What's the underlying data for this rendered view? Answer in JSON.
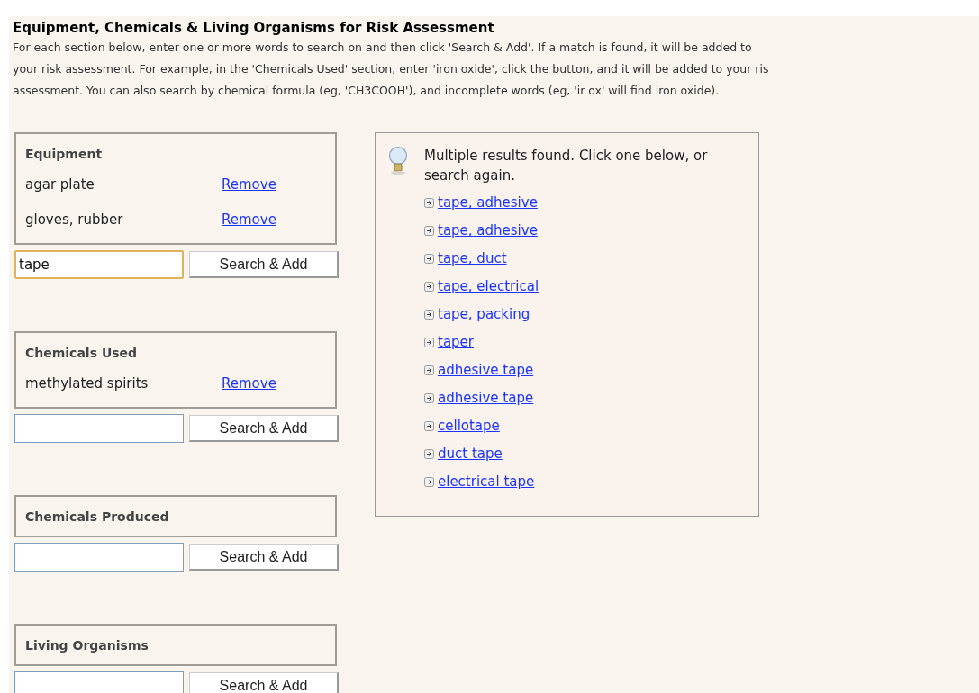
{
  "title": "Equipment, Chemicals & Living Organisms for Risk Assessment",
  "intro_lines": [
    "For each section below, enter one or more words to search on and then click 'Search & Add'. If a match is found, it will be added to",
    "your risk assessment. For example, in the 'Chemicals Used' section, enter 'iron oxide', click the button, and it will be added to your ris",
    "assessment. You can also search by chemical formula (eg, 'CH3COOH'), and incomplete words (eg, 'ir ox' will find iron oxide)."
  ],
  "sections": [
    {
      "heading": "Equipment",
      "items": [
        {
          "name": "agar plate",
          "action": "Remove"
        },
        {
          "name": "gloves, rubber",
          "action": "Remove"
        }
      ],
      "search": {
        "value": "tape",
        "focused": true
      },
      "button": "Search & Add"
    },
    {
      "heading": "Chemicals Used",
      "items": [
        {
          "name": "methylated spirits",
          "action": "Remove"
        }
      ],
      "search": {
        "focused": false
      },
      "button": "Search & Add"
    },
    {
      "heading": "Chemicals Produced",
      "search": {
        "focused": false
      },
      "button": "Search & Add"
    },
    {
      "heading": "Living Organisms",
      "search": {
        "focused": false
      },
      "button": "Search & Add"
    }
  ],
  "results": {
    "message": "Multiple results found. Click one below, or search again.",
    "items": [
      "tape, adhesive",
      "tape, adhesive",
      "tape, duct",
      "tape, electrical",
      "tape, packing",
      "taper",
      "adhesive tape",
      "adhesive tape",
      "cellotape",
      "duct tape",
      "electrical tape"
    ]
  }
}
